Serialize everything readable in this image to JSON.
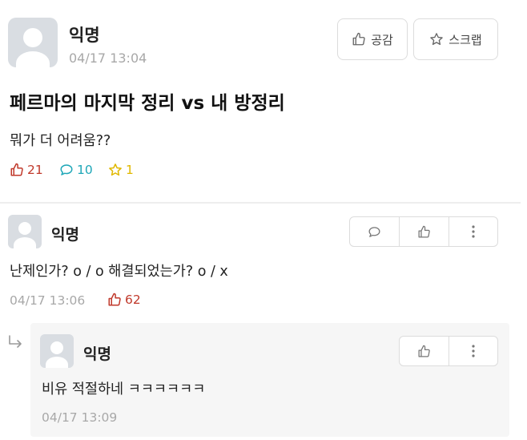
{
  "post": {
    "author": "익명",
    "timestamp": "04/17 13:04",
    "title": "페르마의 마지막 정리 vs 내 방정리",
    "body": "뭐가 더 어려움??",
    "like_button_label": "공감",
    "scrap_button_label": "스크랩",
    "like_count": "21",
    "comment_count": "10",
    "scrap_count": "1"
  },
  "comment": {
    "author": "익명",
    "body": "난제인가? o / o 해결되었는가? o / x",
    "timestamp": "04/17 13:06",
    "like_count": "62"
  },
  "reply": {
    "author": "익명",
    "body": "비유 적절하네 ㅋㅋㅋㅋㅋㅋ",
    "timestamp": "04/17 13:09"
  },
  "colors": {
    "like": "#c0392b",
    "comment": "#1fa7b8",
    "scrap": "#e0b800",
    "muted": "#a8a8a8"
  },
  "icons": {
    "thumb": "thumbs-up-icon",
    "star": "star-icon",
    "bubble": "speech-bubble-icon",
    "more": "more-vertical-icon",
    "reply_arrow": "reply-arrow-icon"
  }
}
